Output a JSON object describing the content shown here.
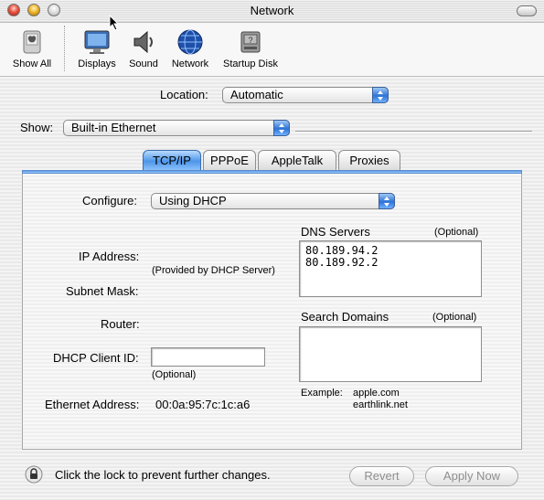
{
  "window": {
    "title": "Network"
  },
  "toolbar": {
    "items": [
      {
        "label": "Show All",
        "icon": "apple-icon"
      },
      {
        "label": "Displays",
        "icon": "display-icon"
      },
      {
        "label": "Sound",
        "icon": "speaker-icon"
      },
      {
        "label": "Network",
        "icon": "globe-icon"
      },
      {
        "label": "Startup Disk",
        "icon": "disk-icon"
      }
    ]
  },
  "location": {
    "label": "Location:",
    "value": "Automatic"
  },
  "show": {
    "label": "Show:",
    "value": "Built-in Ethernet"
  },
  "tabs": [
    {
      "label": "TCP/IP",
      "active": true
    },
    {
      "label": "PPPoE",
      "active": false
    },
    {
      "label": "AppleTalk",
      "active": false
    },
    {
      "label": "Proxies",
      "active": false
    }
  ],
  "tcpip": {
    "configure_label": "Configure:",
    "configure_value": "Using DHCP",
    "ip_address_label": "IP Address:",
    "ip_address_note": "(Provided by DHCP Server)",
    "subnet_mask_label": "Subnet Mask:",
    "router_label": "Router:",
    "dhcp_client_id_label": "DHCP Client ID:",
    "dhcp_client_id_value": "",
    "dhcp_client_id_note": "(Optional)",
    "ethernet_address_label": "Ethernet Address:",
    "ethernet_address_value": "00:0a:95:7c:1c:a6",
    "dns_servers_label": "DNS Servers",
    "dns_servers_optional": "(Optional)",
    "dns_servers": [
      "80.189.94.2",
      "80.189.92.2"
    ],
    "search_domains_label": "Search Domains",
    "search_domains_optional": "(Optional)",
    "example_label": "Example:",
    "example_values": [
      "apple.com",
      "earthlink.net"
    ]
  },
  "footer": {
    "lock_text": "Click the lock to prevent further changes.",
    "revert_label": "Revert",
    "apply_label": "Apply Now"
  }
}
